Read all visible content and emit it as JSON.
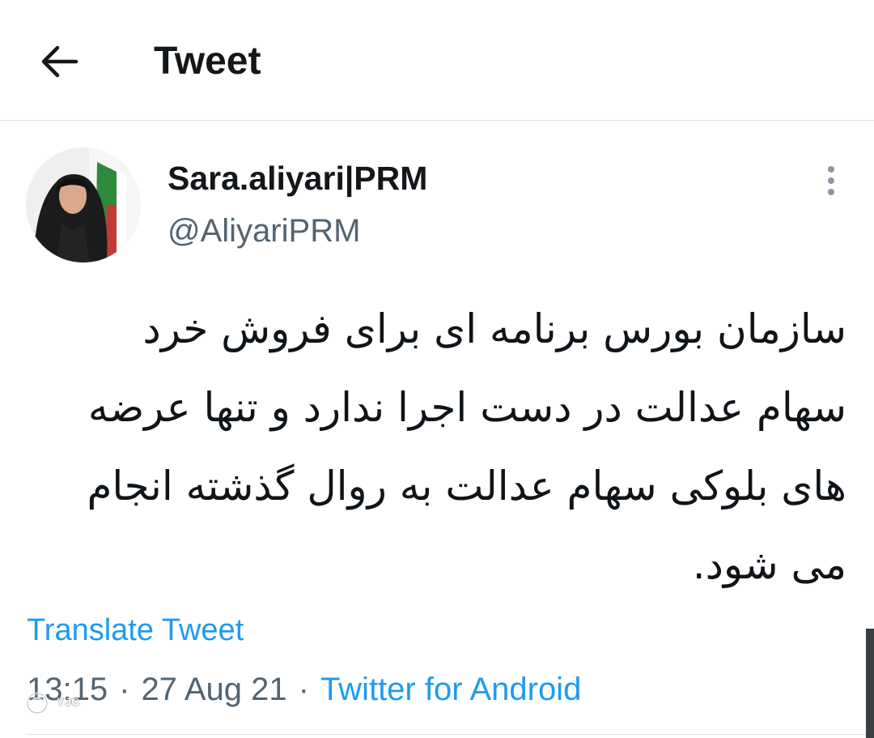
{
  "header": {
    "title": "Tweet",
    "back_icon": "arrow-left-icon"
  },
  "author": {
    "display_name": "Sara.aliyari|PRM",
    "handle": "@AliyariPRM",
    "more_icon": "more-vertical-icon"
  },
  "tweet": {
    "text": "سازمان بورس برنامه ای برای فروش خرد سهام عدالت در دست اجرا ندارد و تنها عرضه های بلوکی سهام عدالت به روال گذشته انجام می شود.",
    "translate_label": "Translate Tweet",
    "time": "13:15",
    "separator": "·",
    "date": "27 Aug 21",
    "source": "Twitter for Android"
  },
  "watermark": {
    "text": "YJC"
  },
  "colors": {
    "accent": "#1d9bf0",
    "secondary_text": "#536471",
    "divider": "#dfe3e7"
  }
}
